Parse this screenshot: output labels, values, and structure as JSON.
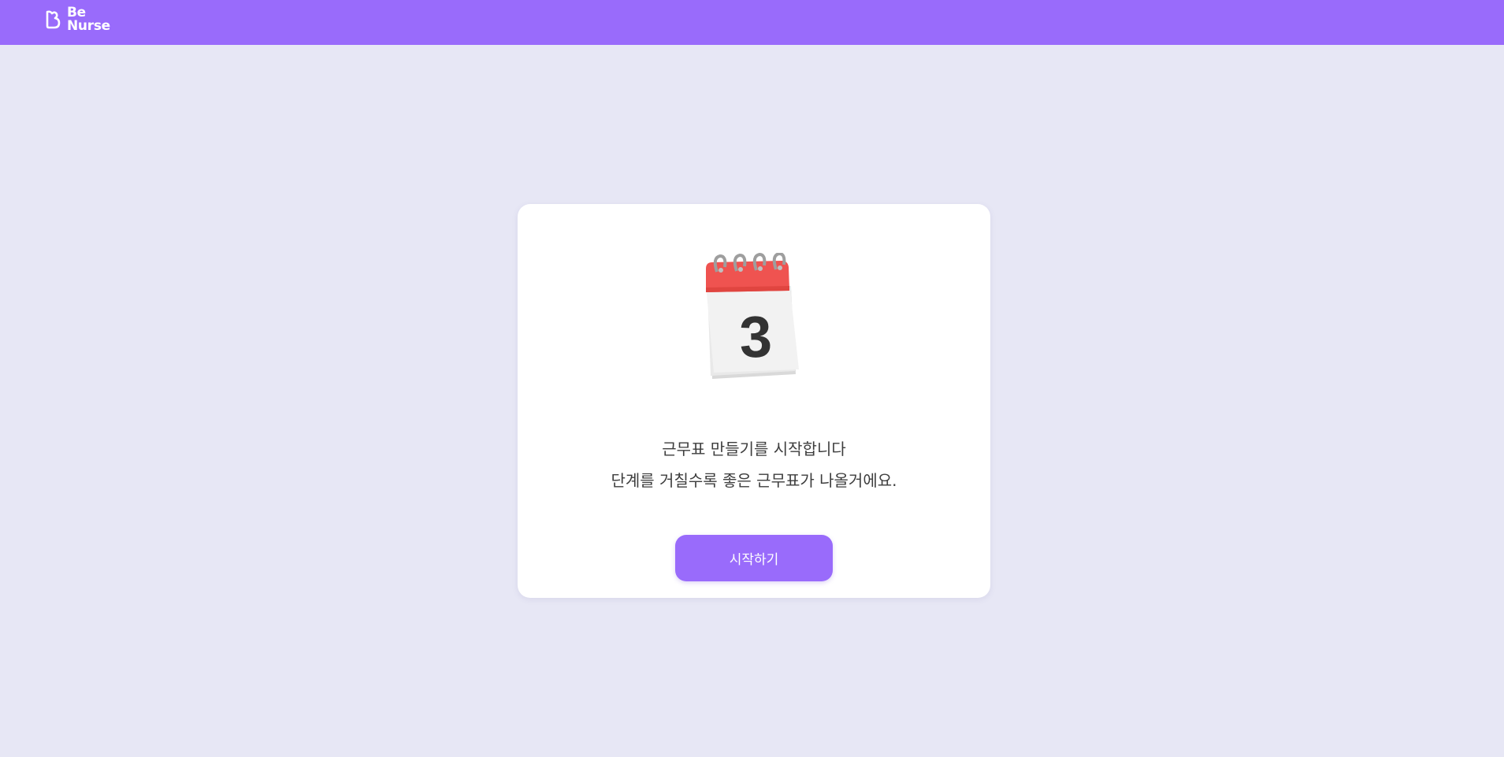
{
  "header": {
    "logo_line1": "Be",
    "logo_line2": "Nurse",
    "logo_icon": "heart-b-icon",
    "bg_color": "#996bfb"
  },
  "main": {
    "illustration": "calendar-icon",
    "calendar_day": "3",
    "message_line1": "근무표 만들기를 시작합니다",
    "message_line2": "단계를 거칠수록 좋은 근무표가 나올거에요.",
    "start_button_label": "시작하기"
  },
  "colors": {
    "accent": "#996bfb",
    "background": "#e7e7f5",
    "card": "#ffffff",
    "calendar_red": "#ef5350"
  }
}
